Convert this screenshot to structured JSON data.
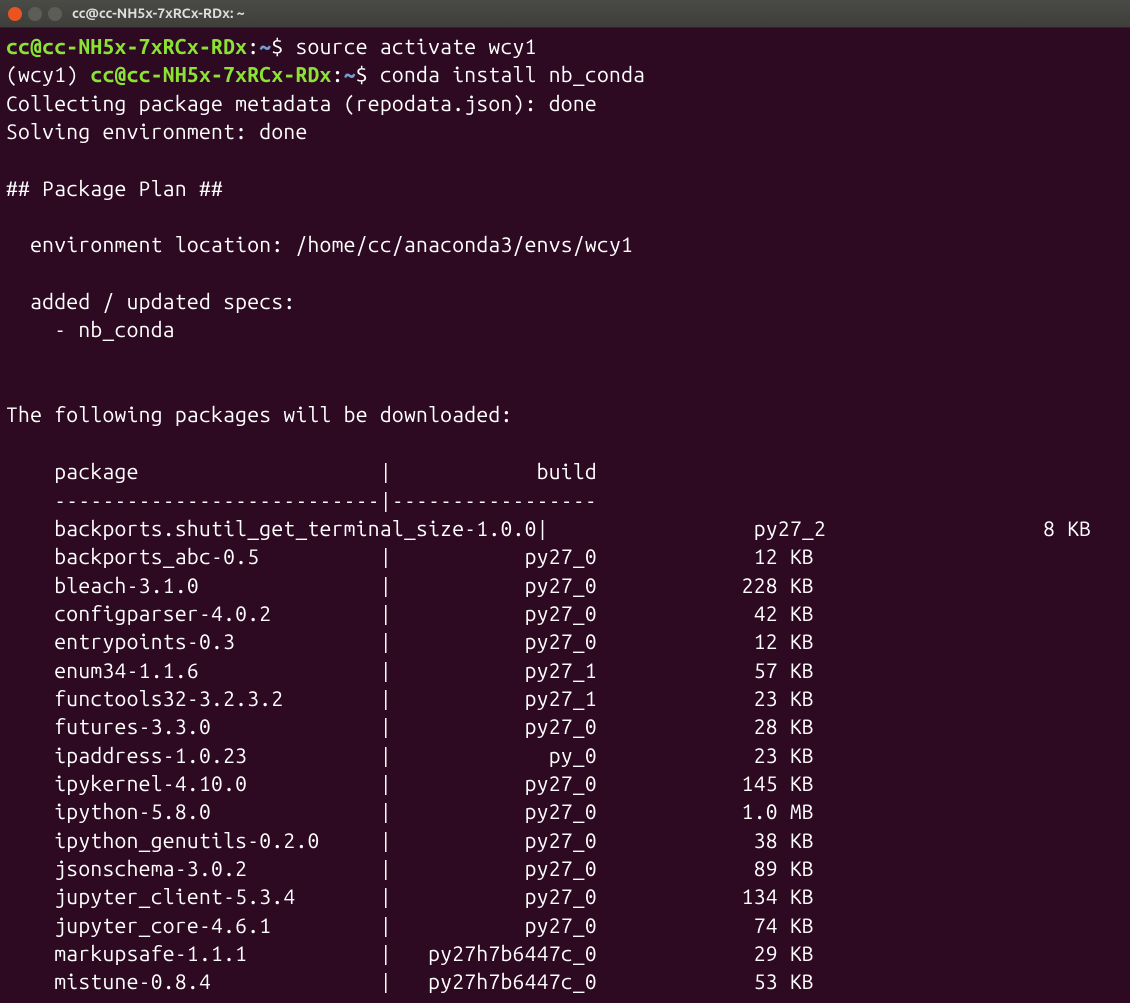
{
  "titlebar": {
    "title": "cc@cc-NH5x-7xRCx-RDx: ~"
  },
  "prompt1": {
    "userhost": "cc@cc-NH5x-7xRCx-RDx",
    "colon": ":",
    "path": "~",
    "dollar": "$",
    "command": "source activate wcy1"
  },
  "prompt2": {
    "env": "(wcy1) ",
    "userhost": "cc@cc-NH5x-7xRCx-RDx",
    "colon": ":",
    "path": "~",
    "dollar": "$",
    "command": "conda install nb_conda"
  },
  "output": {
    "collecting": "Collecting package metadata (repodata.json): done",
    "solving": "Solving environment: done",
    "planHeader": "## Package Plan ##",
    "envLocation": "  environment location: /home/cc/anaconda3/envs/wcy1",
    "addedUpdated": "  added / updated specs:",
    "spec1": "    - nb_conda",
    "downloadHeader": "The following packages will be downloaded:",
    "tableHeader": "    package                    |            build",
    "tableDivider": "    ---------------------------|-----------------"
  },
  "packages": [
    {
      "name": "backports.shutil_get_terminal_size-1.0.0",
      "build": "py27_2",
      "size": "8 KB",
      "wide": true
    },
    {
      "name": "backports_abc-0.5",
      "build": "py27_0",
      "size": "12 KB"
    },
    {
      "name": "bleach-3.1.0",
      "build": "py27_0",
      "size": "228 KB"
    },
    {
      "name": "configparser-4.0.2",
      "build": "py27_0",
      "size": "42 KB"
    },
    {
      "name": "entrypoints-0.3",
      "build": "py27_0",
      "size": "12 KB"
    },
    {
      "name": "enum34-1.1.6",
      "build": "py27_1",
      "size": "57 KB"
    },
    {
      "name": "functools32-3.2.3.2",
      "build": "py27_1",
      "size": "23 KB"
    },
    {
      "name": "futures-3.3.0",
      "build": "py27_0",
      "size": "28 KB"
    },
    {
      "name": "ipaddress-1.0.23",
      "build": "py_0",
      "size": "23 KB"
    },
    {
      "name": "ipykernel-4.10.0",
      "build": "py27_0",
      "size": "145 KB"
    },
    {
      "name": "ipython-5.8.0",
      "build": "py27_0",
      "size": "1.0 MB"
    },
    {
      "name": "ipython_genutils-0.2.0",
      "build": "py27_0",
      "size": "38 KB"
    },
    {
      "name": "jsonschema-3.0.2",
      "build": "py27_0",
      "size": "89 KB"
    },
    {
      "name": "jupyter_client-5.3.4",
      "build": "py27_0",
      "size": "134 KB"
    },
    {
      "name": "jupyter_core-4.6.1",
      "build": "py27_0",
      "size": "74 KB"
    },
    {
      "name": "markupsafe-1.1.1",
      "build": "py27h7b6447c_0",
      "size": "29 KB"
    },
    {
      "name": "mistune-0.8.4",
      "build": "py27h7b6447c_0",
      "size": "53 KB"
    }
  ]
}
